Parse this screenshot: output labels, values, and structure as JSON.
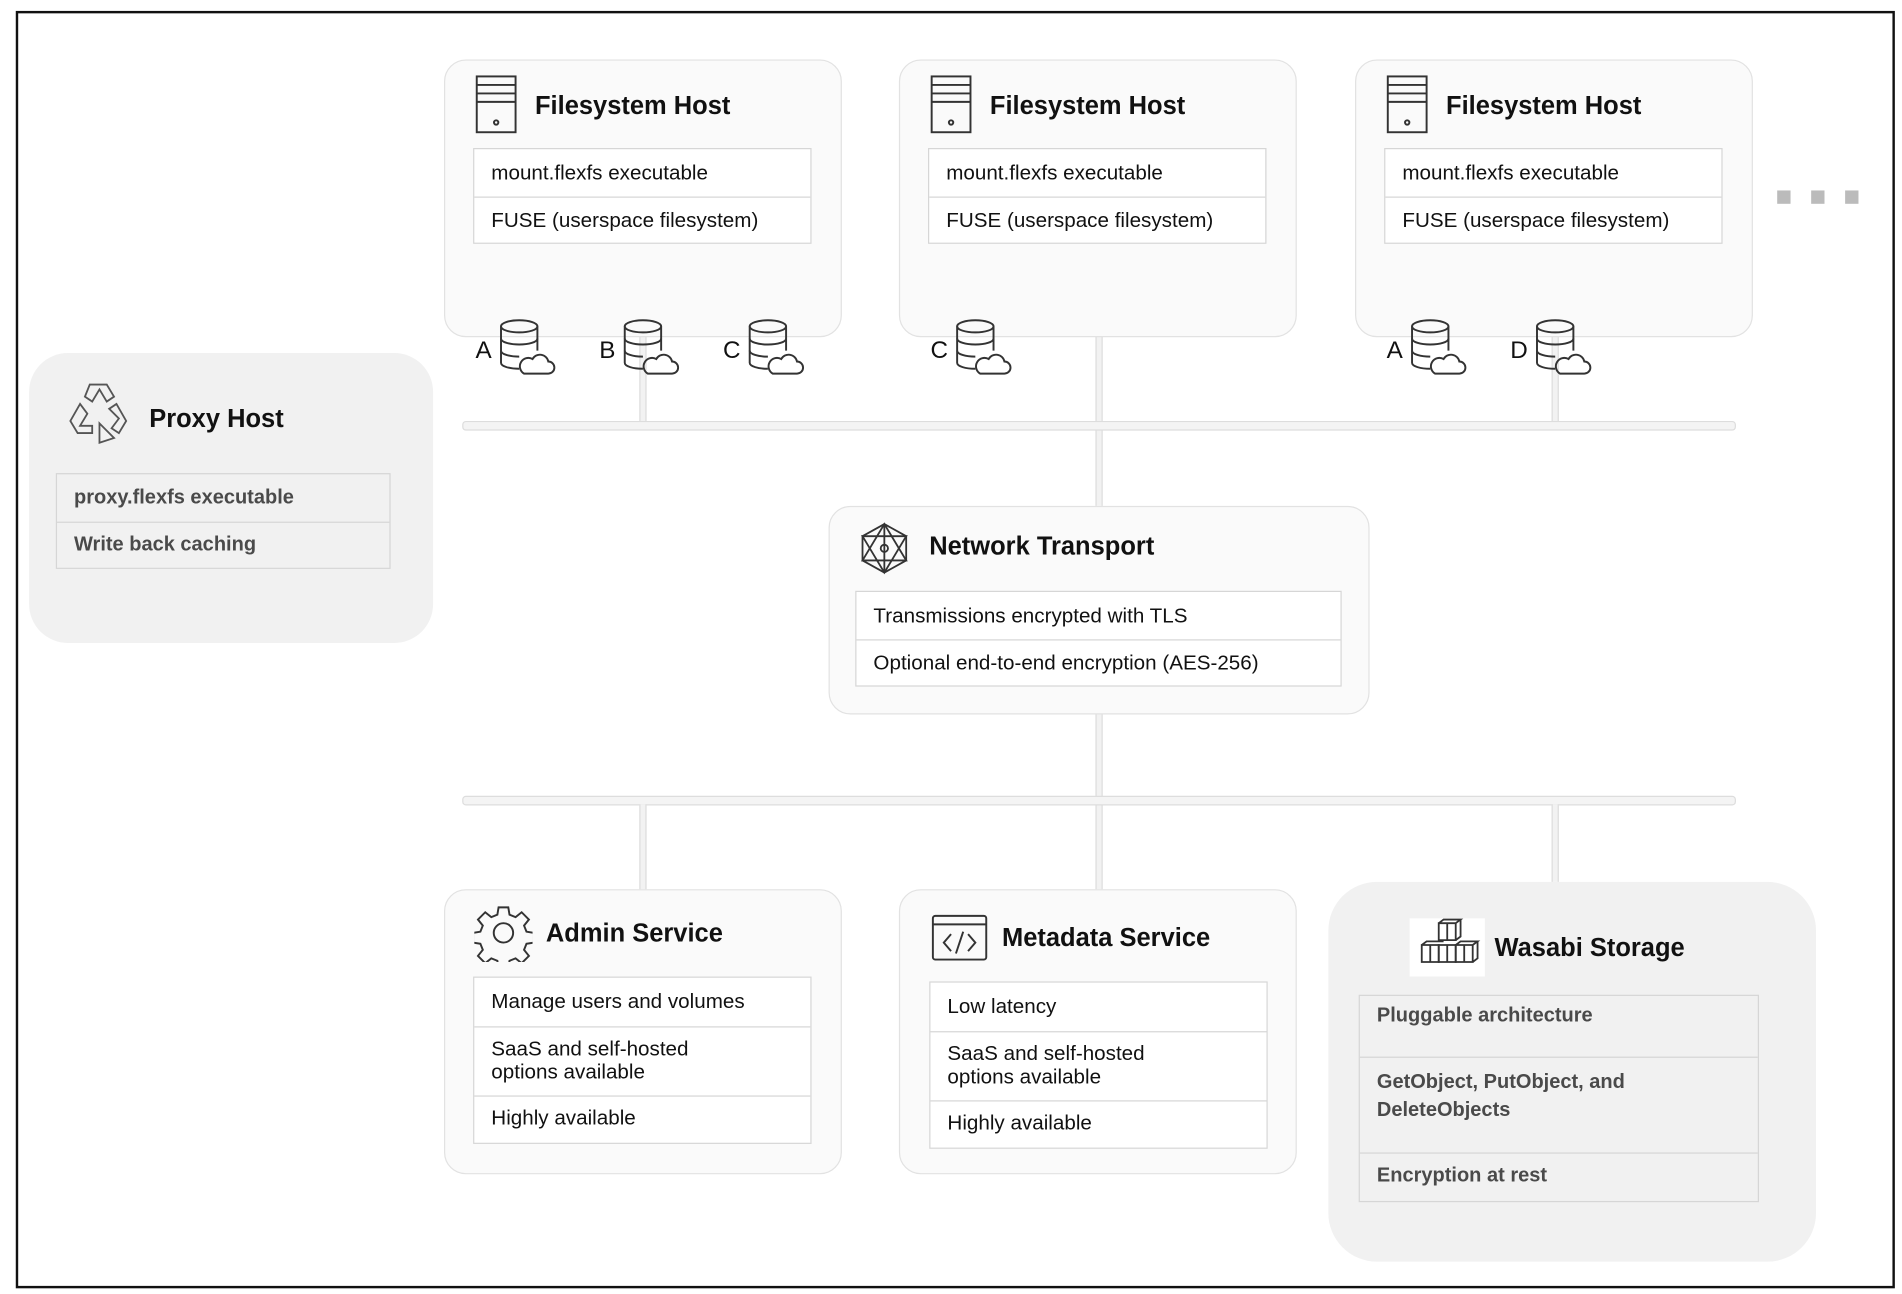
{
  "filesystem_hosts": [
    {
      "title": "Filesystem Host",
      "rows": [
        "mount.flexfs executable",
        "FUSE (userspace filesystem)"
      ],
      "volumes": [
        "A",
        "B",
        "C"
      ]
    },
    {
      "title": "Filesystem Host",
      "rows": [
        "mount.flexfs executable",
        "FUSE (userspace filesystem)"
      ],
      "volumes": [
        "C"
      ]
    },
    {
      "title": "Filesystem Host",
      "rows": [
        "mount.flexfs executable",
        "FUSE (userspace filesystem)"
      ],
      "volumes": [
        "A",
        "D"
      ]
    }
  ],
  "proxy_host": {
    "title": "Proxy Host",
    "rows": [
      "proxy.flexfs executable",
      "Write back caching"
    ]
  },
  "network_transport": {
    "title": "Network Transport",
    "rows": [
      "Transmissions encrypted with TLS",
      "Optional end-to-end encryption (AES-256)"
    ]
  },
  "admin_service": {
    "title": "Admin Service",
    "rows": [
      "Manage users and volumes",
      "SaaS and self-hosted options available",
      "Highly available"
    ]
  },
  "metadata_service": {
    "title": "Metadata Service",
    "rows": [
      "Low latency",
      "SaaS and self-hosted options available",
      "Highly available"
    ]
  },
  "wasabi_storage": {
    "title": "Wasabi Storage",
    "rows": [
      "Pluggable architecture",
      "GetObject, PutObject, and DeleteObjects",
      "Encryption at rest"
    ]
  },
  "icons": {
    "filesystem_host": "server-icon",
    "volume": "database-cloud-icon",
    "proxy_host": "recycle-icon",
    "network_transport": "network-mesh-icon",
    "admin_service": "gear-icon",
    "metadata_service": "code-window-icon",
    "wasabi_storage": "cubes-icon",
    "more": "ellipsis-icon"
  }
}
